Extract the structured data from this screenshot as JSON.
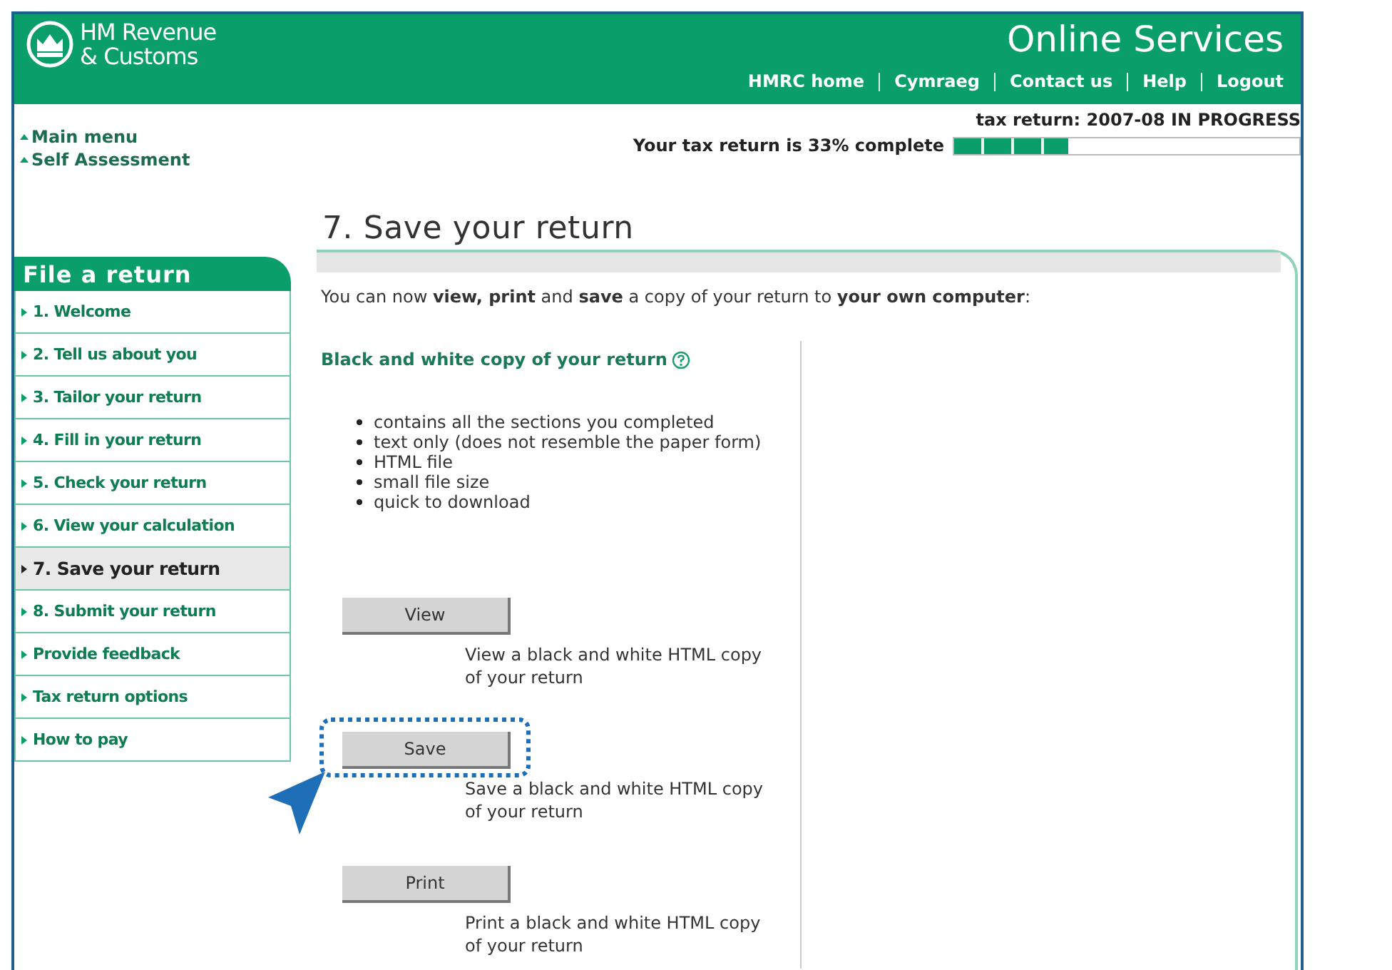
{
  "header": {
    "logo_lines": [
      "HM Revenue",
      "& Customs"
    ],
    "title": "Online Services",
    "links": [
      "HMRC home",
      "Cymraeg",
      "Contact us",
      "Help",
      "Logout"
    ]
  },
  "nav_links": [
    "Main menu",
    "Self Assessment"
  ],
  "status": {
    "text": "tax return: 2007-08  IN PROGRESS",
    "progress_text": "Your tax return is 33% complete",
    "level": 0.33
  },
  "sidebar": {
    "title": "File a return",
    "items": [
      {
        "label": "1. Welcome",
        "selected": false
      },
      {
        "label": "2. Tell us about you",
        "selected": false
      },
      {
        "label": "3. Tailor your return",
        "selected": false
      },
      {
        "label": "4. Fill in your return",
        "selected": false
      },
      {
        "label": "5. Check your return",
        "selected": false
      },
      {
        "label": "6. View your calculation",
        "selected": false
      },
      {
        "label": "7. Save your return",
        "selected": true
      },
      {
        "label": "8. Submit your return",
        "selected": false
      },
      {
        "label": "Provide feedback",
        "selected": false
      },
      {
        "label": "Tax return options",
        "selected": false
      },
      {
        "label": "How to pay",
        "selected": false
      }
    ]
  },
  "page_title": "7. Save your return",
  "intro": "You can now **view, print** and **save** a copy of your return to **your own computer**:",
  "section": {
    "heading": "Black and white copy of your return",
    "bullets": [
      "contains all the sections you completed",
      "text only (does not resemble the paper form)",
      "HTML file",
      "small file size",
      "quick to download"
    ]
  },
  "actions": [
    {
      "label": "View",
      "description": "View a black and white HTML copy of your return",
      "highlighted": false
    },
    {
      "label": "Save",
      "description": "Save a black and white HTML copy of your return",
      "highlighted": true
    },
    {
      "label": "Print",
      "description": "Print a black and white HTML copy of your return",
      "highlighted": false
    }
  ]
}
